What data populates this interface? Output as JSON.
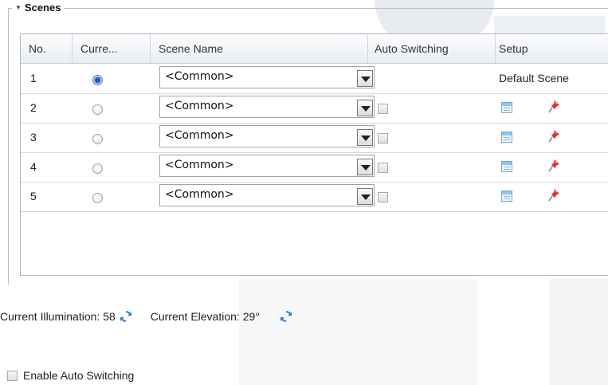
{
  "section": {
    "title": "Scenes"
  },
  "table": {
    "columns": [
      "No.",
      "Curre...",
      "Scene Name",
      "Auto Switching",
      "Setup"
    ],
    "rows": [
      {
        "no": "1",
        "current": true,
        "scene": "<Common>",
        "auto_switch": null,
        "setup_text": "Default Scene"
      },
      {
        "no": "2",
        "current": false,
        "scene": "<Common>",
        "auto_switch": false,
        "setup_text": null
      },
      {
        "no": "3",
        "current": false,
        "scene": "<Common>",
        "auto_switch": false,
        "setup_text": null
      },
      {
        "no": "4",
        "current": false,
        "scene": "<Common>",
        "auto_switch": false,
        "setup_text": null
      },
      {
        "no": "5",
        "current": false,
        "scene": "<Common>",
        "auto_switch": false,
        "setup_text": null
      }
    ]
  },
  "status": {
    "illumination_label": "Current Illumination: 58",
    "elevation_label": "Current Elevation: 29°"
  },
  "auto_switching": {
    "label": "Enable Auto Switching",
    "checked": false
  },
  "icons": {
    "refresh": "refresh-icon",
    "calendar": "calendar-icon",
    "pin": "pushpin-icon"
  }
}
